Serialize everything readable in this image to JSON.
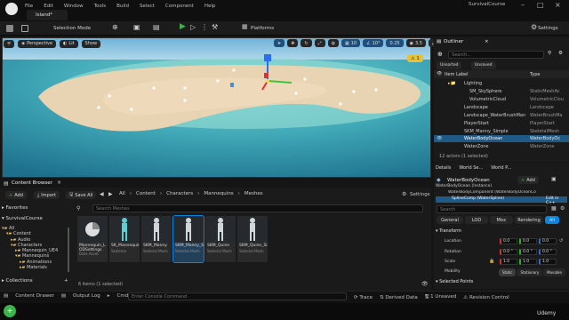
{
  "app": {
    "menu": [
      "File",
      "Edit",
      "Window",
      "Tools",
      "Build",
      "Select",
      "Component",
      "Help"
    ],
    "doc_tab": "Island*",
    "project": "SurvivalCourse"
  },
  "toolbar": {
    "selection_mode": "Selection Mode",
    "platforms": "Platforms",
    "settings": "Settings"
  },
  "viewport": {
    "perspective": "Perspective",
    "lit": "Lit",
    "show": "Show",
    "grid_snap": "10",
    "angle_snap": "10°",
    "scale_snap": "0.25",
    "camera_speed": "3.5",
    "warning_count": "1"
  },
  "outliner": {
    "tab": "Outliner",
    "search_placeholder": "Search...",
    "filters": [
      "Unsorted",
      "Unsaved"
    ],
    "col_label": "Item Label",
    "col_type": "Type",
    "rows": [
      {
        "label": "Lighting",
        "type": ""
      },
      {
        "label": "SM_SkySphere",
        "type": "StaticMeshAc"
      },
      {
        "label": "VolumetricCloud",
        "type": "VolumetricClou"
      },
      {
        "label": "Landscape",
        "type": "Landscape"
      },
      {
        "label": "Landscape_WaterBrushMan",
        "type": "WaterBrushMa"
      },
      {
        "label": "PlayerStart",
        "type": "PlayerStart"
      },
      {
        "label": "SKM_Manny_Simple",
        "type": "SkeletalMesh"
      },
      {
        "label": "WaterBodyOcean",
        "type": "WaterBodyOc"
      },
      {
        "label": "WaterZone",
        "type": "WaterZone"
      }
    ],
    "status": "12 actors (1 selected)"
  },
  "details": {
    "tabs": [
      "Details",
      "World Se...",
      "World P..."
    ],
    "object": "WaterBodyOcean",
    "add": "Add",
    "components": [
      "WaterBodyOcean (Instance)",
      "WaterBodyComponent (WaterBodyOceanCo",
      "SplineComp (WaterSpline)"
    ],
    "edit_cpp": "Edit in C++",
    "search_placeholder": "Search",
    "filter_tabs": [
      "General",
      "LOD",
      "Misc",
      "Rendering",
      "All"
    ],
    "section_transform": "Transform",
    "location_label": "Location",
    "location": [
      "0.0",
      "0.0",
      "0.0"
    ],
    "rotation_label": "Rotation",
    "rotation": [
      "0.0 °",
      "0.0 °",
      "0.0 °"
    ],
    "scale_label": "Scale",
    "scale": [
      "1.0",
      "1.0",
      "1.0"
    ],
    "mobility_label": "Mobility",
    "mobility": [
      "Static",
      "Stationary",
      "Movable"
    ],
    "section_selected": "Selected Points"
  },
  "content_browser": {
    "tab": "Content Browser",
    "add": "Add",
    "import": "Import",
    "save_all": "Save All",
    "breadcrumb": [
      "All",
      "Content",
      "Characters",
      "Mannequins",
      "Meshes"
    ],
    "settings": "Settings",
    "favorites": "Favorites",
    "project": "SurvivalCourse",
    "search_placeholder": "Search Meshes",
    "tree": [
      "All",
      "Content",
      "Audio",
      "Characters",
      "Mannequin_UE4",
      "Mannequins",
      "Animations",
      "Materials"
    ],
    "collections": "Collections",
    "assets": [
      {
        "name": "Mannequin_LODSettings",
        "type": "Data Asset"
      },
      {
        "name": "SK_Mannequin",
        "type": "Skeleton"
      },
      {
        "name": "SKM_Manny",
        "type": "Skeletal Mesh"
      },
      {
        "name": "SKM_Manny_Simple",
        "type": "Skeletal Mesh"
      },
      {
        "name": "SKM_Quinn",
        "type": "Skeletal Mesh"
      },
      {
        "name": "SKM_Quinn_Simple",
        "type": "Skeletal Mesh"
      }
    ],
    "status": "6 items (1 selected)"
  },
  "statusbar": {
    "content_drawer": "Content Drawer",
    "output_log": "Output Log",
    "cmd": "Cmd",
    "console_placeholder": "Enter Console Command",
    "trace": "Trace",
    "derived_data": "Derived Data",
    "unsaved": "1 Unsaved",
    "revision_control": "Revision Control"
  },
  "watermark": "Udemy",
  "colors": {
    "accent": "#0a84e0",
    "selected_row": "#1f5a87",
    "play_green": "#3cb44b"
  }
}
